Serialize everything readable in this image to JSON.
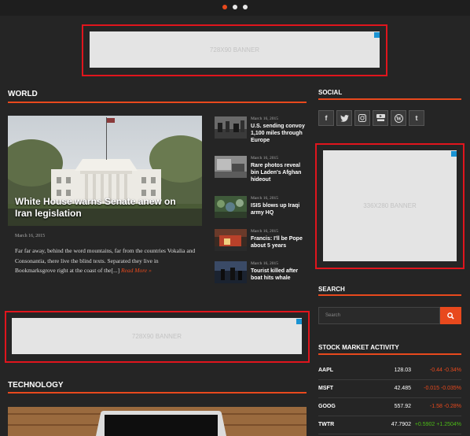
{
  "colors": {
    "accent": "#e8491d",
    "ad_border": "#e0151d",
    "ad_fill": "#e4e4e4",
    "ad_corner": "#1a93d3",
    "positive": "#4cbb17",
    "negative": "#e8491d",
    "background": "#252525"
  },
  "slider": {
    "dots": 3,
    "active_index": 0
  },
  "ads": {
    "top": "728X90 BANNER",
    "middle": "728X90 BANNER",
    "side": "336X280 BANNER"
  },
  "world": {
    "heading": "WORLD",
    "feature": {
      "title": "White House warns Senate anew on Iran legislation",
      "date": "March 16, 2015",
      "excerpt": "Far far away, behind the word mountains, far from the countries Vokalia and Consonantia, there live the blind texts. Separated they live in Bookmarksgrove right at the coast of the[...] ",
      "read_more": "Read More »"
    },
    "side_items": [
      {
        "date": "March 16, 2015",
        "title": "U.S. sending convoy 1,100 miles through Europe"
      },
      {
        "date": "March 16, 2015",
        "title": "Rare photos reveal bin Laden's Afghan hideout"
      },
      {
        "date": "March 16, 2015",
        "title": "ISIS blows up Iraqi army HQ"
      },
      {
        "date": "March 16, 2015",
        "title": "Francis: I'll be Pope about 5 years"
      },
      {
        "date": "March 16, 2015",
        "title": "Tourist killed after boat hits whale"
      }
    ]
  },
  "technology": {
    "heading": "TECHNOLOGY"
  },
  "social": {
    "heading": "SOCIAL",
    "icons": [
      {
        "name": "facebook-icon",
        "glyph": "f"
      },
      {
        "name": "twitter-icon",
        "glyph": "🐦"
      },
      {
        "name": "instagram-icon",
        "glyph": "◙"
      },
      {
        "name": "youtube-icon",
        "glyph": "▶"
      },
      {
        "name": "wordpress-icon",
        "glyph": "W"
      },
      {
        "name": "tumblr-icon",
        "glyph": "t"
      }
    ]
  },
  "search": {
    "heading": "SEARCH",
    "placeholder": "Search"
  },
  "stocks": {
    "heading": "STOCK MARKET ACTIVITY",
    "rows": [
      {
        "symbol": "AAPL",
        "price": "128.03",
        "change": "-0.44 -0.34%",
        "direction": "neg"
      },
      {
        "symbol": "MSFT",
        "price": "42.485",
        "change": "-0.015 -0.035%",
        "direction": "neg"
      },
      {
        "symbol": "GOOG",
        "price": "557.92",
        "change": "-1.58 -0.28%",
        "direction": "neg"
      },
      {
        "symbol": "TWTR",
        "price": "47.7902",
        "change": "+0.5902 +1.2504%",
        "direction": "pos"
      }
    ]
  }
}
